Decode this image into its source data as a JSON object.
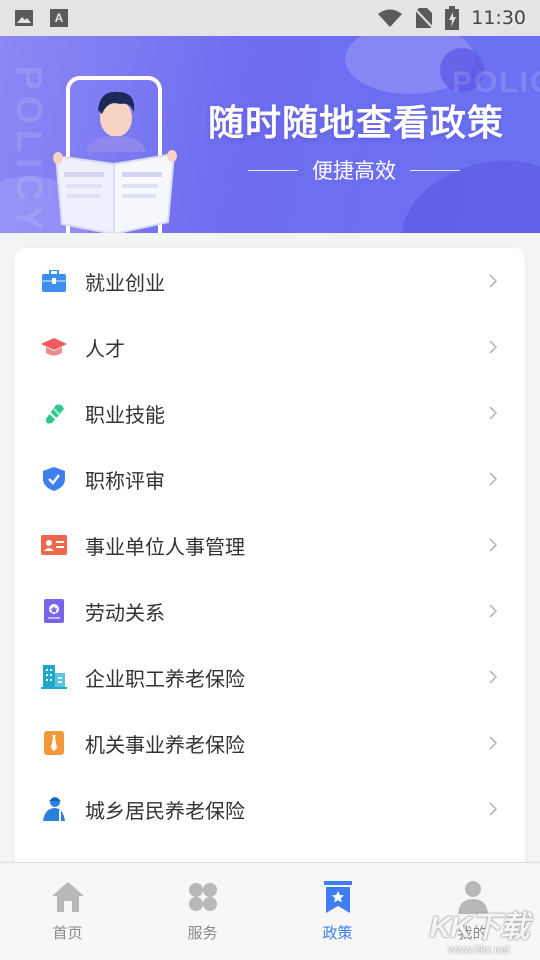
{
  "status_bar": {
    "time": "11:30",
    "left_icons": [
      "image-icon",
      "font-icon"
    ],
    "right_icons": [
      "wifi-icon",
      "no-sim-icon",
      "battery-charging-icon"
    ]
  },
  "banner": {
    "title": "随时随地查看政策",
    "subtitle": "便捷高效",
    "watermark": "POLICY",
    "colors": {
      "gradient_start": "#8d88f5",
      "gradient_end": "#6a72f2"
    }
  },
  "policy_list": {
    "items": [
      {
        "label": "就业创业",
        "icon": "briefcase-icon",
        "color": "#3b8ef0"
      },
      {
        "label": "人才",
        "icon": "graduation-cap-icon",
        "color": "#ef5a5a"
      },
      {
        "label": "职业技能",
        "icon": "tool-icon",
        "color": "#2fc98f"
      },
      {
        "label": "职称评审",
        "icon": "shield-check-icon",
        "color": "#3b7ff0"
      },
      {
        "label": "事业单位人事管理",
        "icon": "id-card-icon",
        "color": "#f0674e"
      },
      {
        "label": "劳动关系",
        "icon": "certificate-book-icon",
        "color": "#7a63e8"
      },
      {
        "label": "企业职工养老保险",
        "icon": "building-icon",
        "color": "#21a7c9"
      },
      {
        "label": "机关事业养老保险",
        "icon": "tie-icon",
        "color": "#f29a3a"
      },
      {
        "label": "城乡居民养老保险",
        "icon": "worker-icon",
        "color": "#2a7fe0"
      }
    ]
  },
  "bottom_nav": {
    "tabs": [
      {
        "label": "首页",
        "icon": "home-icon",
        "active": false
      },
      {
        "label": "服务",
        "icon": "grid-icon",
        "active": false
      },
      {
        "label": "政策",
        "icon": "policy-bookmark-icon",
        "active": true
      },
      {
        "label": "我的",
        "icon": "user-icon",
        "active": false
      }
    ],
    "active_color": "#3f7df2",
    "inactive_color": "#b8b8b8"
  },
  "site_watermark": {
    "big": "KK下载",
    "small": "www.kkx.net"
  }
}
